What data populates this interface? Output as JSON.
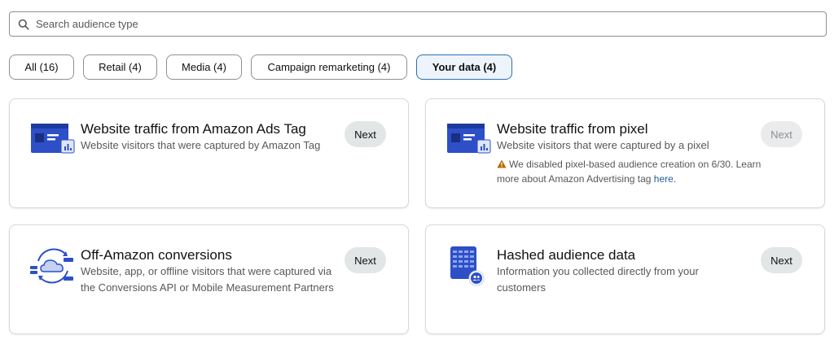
{
  "search": {
    "placeholder": "Search audience type",
    "icon": "search-icon"
  },
  "filters": [
    {
      "label": "All (16)",
      "active": false
    },
    {
      "label": "Retail (4)",
      "active": false
    },
    {
      "label": "Media (4)",
      "active": false
    },
    {
      "label": "Campaign remarketing (4)",
      "active": false
    },
    {
      "label": "Your data (4)",
      "active": true
    }
  ],
  "cards": [
    {
      "title": "Website traffic from Amazon Ads Tag",
      "description": "Website visitors that were captured by Amazon Tag",
      "icon": "website-browser-icon",
      "next_label": "Next",
      "next_enabled": true
    },
    {
      "title": "Website traffic from pixel",
      "description": "Website visitors that were captured by a pixel",
      "warning_text": "We disabled pixel-based audience creation on 6/30. Learn more about Amazon Advertising tag",
      "warning_link": "here",
      "warning_suffix": ".",
      "icon": "website-browser-icon",
      "next_label": "Next",
      "next_enabled": false
    },
    {
      "title": "Off-Amazon conversions",
      "description": "Website, app, or offline visitors that were captured via the Conversions API or Mobile Measurement Partners",
      "icon": "cloud-sync-icon",
      "next_label": "Next",
      "next_enabled": true
    },
    {
      "title": "Hashed audience data",
      "description": "Information you collected directly from your customers",
      "icon": "hashed-data-icon",
      "next_label": "Next",
      "next_enabled": true
    }
  ],
  "colors": {
    "accent": "#2a6fb3",
    "illustration_blue": "#2d4fc8",
    "warning": "#b36b00",
    "link": "#2162a1"
  }
}
